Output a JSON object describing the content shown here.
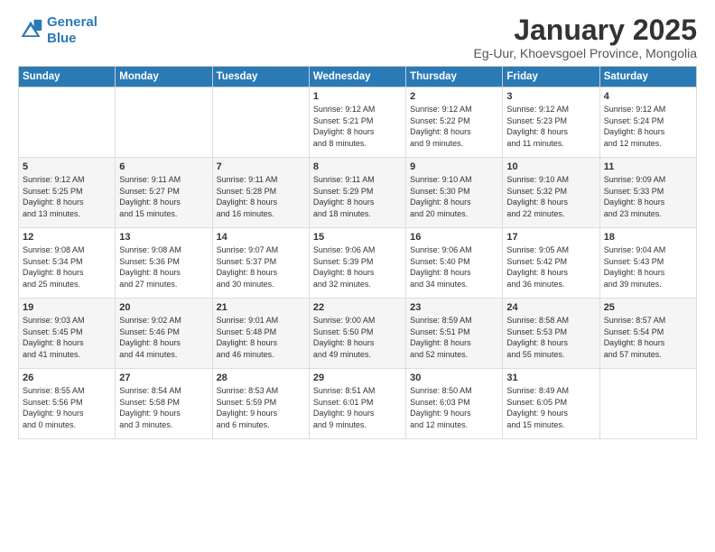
{
  "logo": {
    "line1": "General",
    "line2": "Blue"
  },
  "title": "January 2025",
  "subtitle": "Eg-Uur, Khoevsgoel Province, Mongolia",
  "weekdays": [
    "Sunday",
    "Monday",
    "Tuesday",
    "Wednesday",
    "Thursday",
    "Friday",
    "Saturday"
  ],
  "weeks": [
    [
      {
        "day": "",
        "info": ""
      },
      {
        "day": "",
        "info": ""
      },
      {
        "day": "",
        "info": ""
      },
      {
        "day": "1",
        "info": "Sunrise: 9:12 AM\nSunset: 5:21 PM\nDaylight: 8 hours\nand 8 minutes."
      },
      {
        "day": "2",
        "info": "Sunrise: 9:12 AM\nSunset: 5:22 PM\nDaylight: 8 hours\nand 9 minutes."
      },
      {
        "day": "3",
        "info": "Sunrise: 9:12 AM\nSunset: 5:23 PM\nDaylight: 8 hours\nand 11 minutes."
      },
      {
        "day": "4",
        "info": "Sunrise: 9:12 AM\nSunset: 5:24 PM\nDaylight: 8 hours\nand 12 minutes."
      }
    ],
    [
      {
        "day": "5",
        "info": "Sunrise: 9:12 AM\nSunset: 5:25 PM\nDaylight: 8 hours\nand 13 minutes."
      },
      {
        "day": "6",
        "info": "Sunrise: 9:11 AM\nSunset: 5:27 PM\nDaylight: 8 hours\nand 15 minutes."
      },
      {
        "day": "7",
        "info": "Sunrise: 9:11 AM\nSunset: 5:28 PM\nDaylight: 8 hours\nand 16 minutes."
      },
      {
        "day": "8",
        "info": "Sunrise: 9:11 AM\nSunset: 5:29 PM\nDaylight: 8 hours\nand 18 minutes."
      },
      {
        "day": "9",
        "info": "Sunrise: 9:10 AM\nSunset: 5:30 PM\nDaylight: 8 hours\nand 20 minutes."
      },
      {
        "day": "10",
        "info": "Sunrise: 9:10 AM\nSunset: 5:32 PM\nDaylight: 8 hours\nand 22 minutes."
      },
      {
        "day": "11",
        "info": "Sunrise: 9:09 AM\nSunset: 5:33 PM\nDaylight: 8 hours\nand 23 minutes."
      }
    ],
    [
      {
        "day": "12",
        "info": "Sunrise: 9:08 AM\nSunset: 5:34 PM\nDaylight: 8 hours\nand 25 minutes."
      },
      {
        "day": "13",
        "info": "Sunrise: 9:08 AM\nSunset: 5:36 PM\nDaylight: 8 hours\nand 27 minutes."
      },
      {
        "day": "14",
        "info": "Sunrise: 9:07 AM\nSunset: 5:37 PM\nDaylight: 8 hours\nand 30 minutes."
      },
      {
        "day": "15",
        "info": "Sunrise: 9:06 AM\nSunset: 5:39 PM\nDaylight: 8 hours\nand 32 minutes."
      },
      {
        "day": "16",
        "info": "Sunrise: 9:06 AM\nSunset: 5:40 PM\nDaylight: 8 hours\nand 34 minutes."
      },
      {
        "day": "17",
        "info": "Sunrise: 9:05 AM\nSunset: 5:42 PM\nDaylight: 8 hours\nand 36 minutes."
      },
      {
        "day": "18",
        "info": "Sunrise: 9:04 AM\nSunset: 5:43 PM\nDaylight: 8 hours\nand 39 minutes."
      }
    ],
    [
      {
        "day": "19",
        "info": "Sunrise: 9:03 AM\nSunset: 5:45 PM\nDaylight: 8 hours\nand 41 minutes."
      },
      {
        "day": "20",
        "info": "Sunrise: 9:02 AM\nSunset: 5:46 PM\nDaylight: 8 hours\nand 44 minutes."
      },
      {
        "day": "21",
        "info": "Sunrise: 9:01 AM\nSunset: 5:48 PM\nDaylight: 8 hours\nand 46 minutes."
      },
      {
        "day": "22",
        "info": "Sunrise: 9:00 AM\nSunset: 5:50 PM\nDaylight: 8 hours\nand 49 minutes."
      },
      {
        "day": "23",
        "info": "Sunrise: 8:59 AM\nSunset: 5:51 PM\nDaylight: 8 hours\nand 52 minutes."
      },
      {
        "day": "24",
        "info": "Sunrise: 8:58 AM\nSunset: 5:53 PM\nDaylight: 8 hours\nand 55 minutes."
      },
      {
        "day": "25",
        "info": "Sunrise: 8:57 AM\nSunset: 5:54 PM\nDaylight: 8 hours\nand 57 minutes."
      }
    ],
    [
      {
        "day": "26",
        "info": "Sunrise: 8:55 AM\nSunset: 5:56 PM\nDaylight: 9 hours\nand 0 minutes."
      },
      {
        "day": "27",
        "info": "Sunrise: 8:54 AM\nSunset: 5:58 PM\nDaylight: 9 hours\nand 3 minutes."
      },
      {
        "day": "28",
        "info": "Sunrise: 8:53 AM\nSunset: 5:59 PM\nDaylight: 9 hours\nand 6 minutes."
      },
      {
        "day": "29",
        "info": "Sunrise: 8:51 AM\nSunset: 6:01 PM\nDaylight: 9 hours\nand 9 minutes."
      },
      {
        "day": "30",
        "info": "Sunrise: 8:50 AM\nSunset: 6:03 PM\nDaylight: 9 hours\nand 12 minutes."
      },
      {
        "day": "31",
        "info": "Sunrise: 8:49 AM\nSunset: 6:05 PM\nDaylight: 9 hours\nand 15 minutes."
      },
      {
        "day": "",
        "info": ""
      }
    ]
  ]
}
